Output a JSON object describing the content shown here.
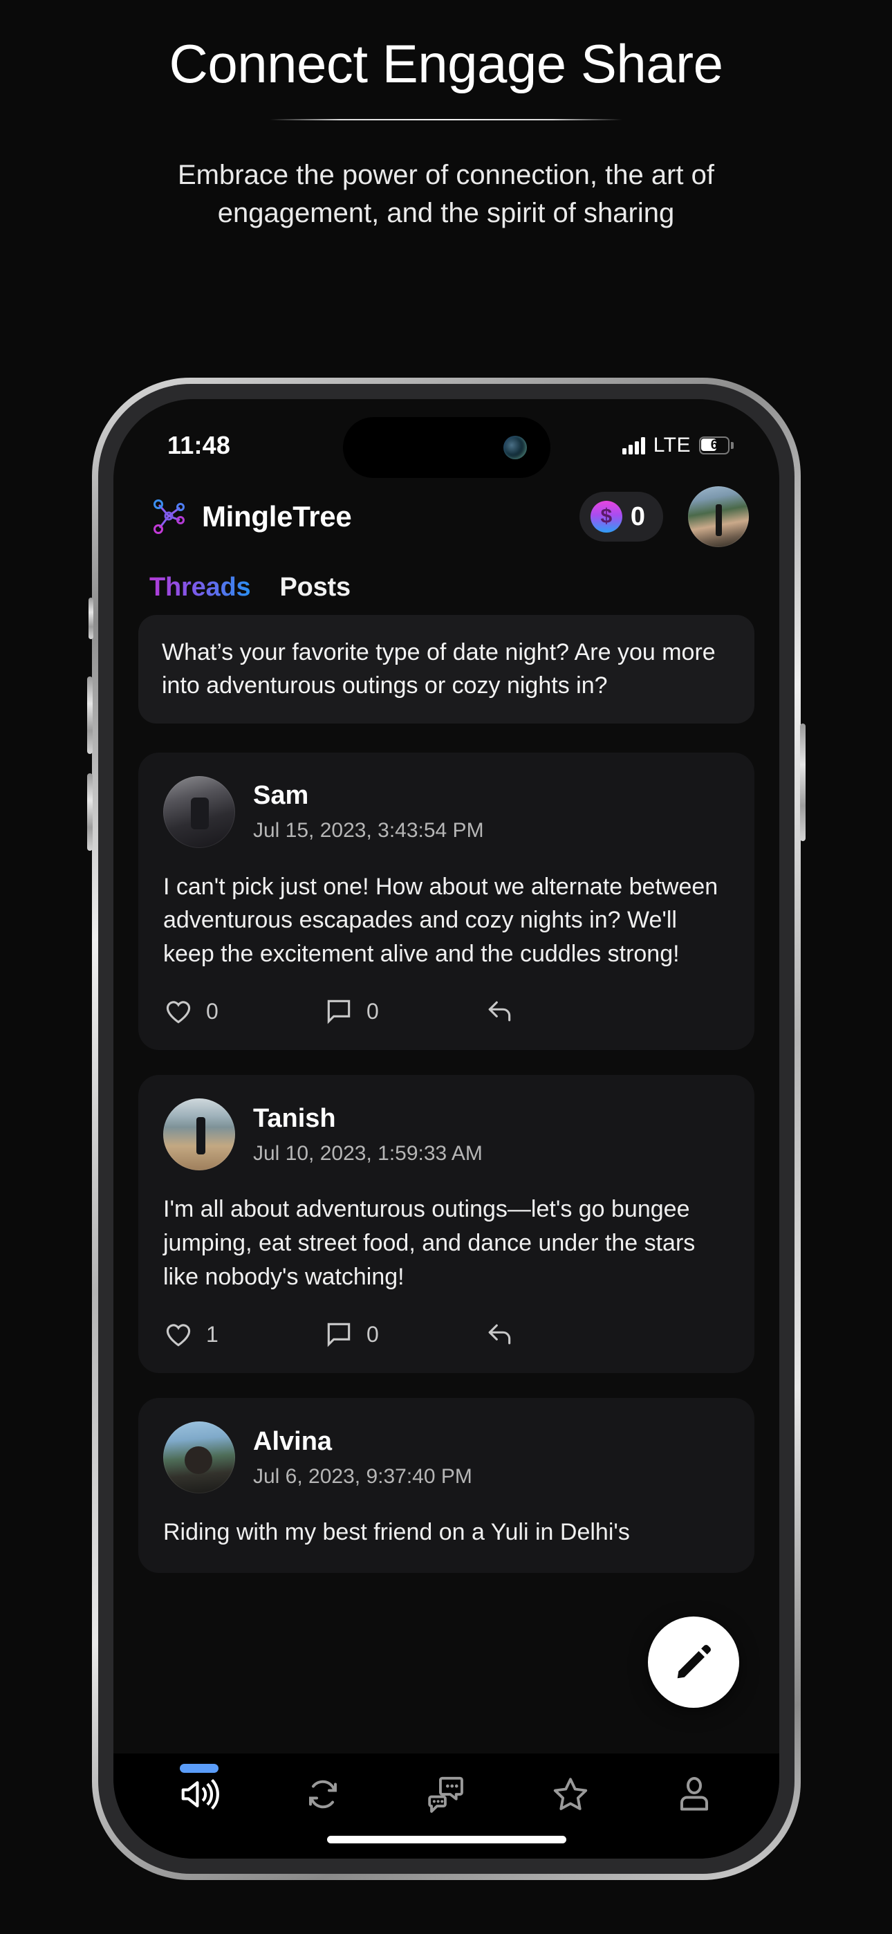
{
  "promo": {
    "title": "Connect Engage Share",
    "subtitle": "Embrace the power of connection, the art of engagement, and the spirit of sharing"
  },
  "status_bar": {
    "time": "11:48",
    "network": "LTE",
    "battery_level": "6",
    "signal_icon": "signal-bars-icon"
  },
  "app": {
    "name": "MingleTree",
    "logo_icon": "network-tree-icon",
    "coin_icon": "coin-dollar-icon",
    "coin_count": "0",
    "avatar_icon": "user-avatar"
  },
  "tabs": [
    {
      "label": "Threads",
      "active": true
    },
    {
      "label": "Posts",
      "active": false
    }
  ],
  "question": {
    "text": "What’s your favorite type of date night? Are you more into adventurous outings or cozy nights in?"
  },
  "posts": [
    {
      "author": "Sam",
      "timestamp": "Jul 15, 2023, 3:43:54 PM",
      "body": "I can't pick just one! How about we alternate between adventurous escapades and cozy nights in? We'll keep the excitement alive and the cuddles strong!",
      "like_count": "0",
      "comment_count": "0",
      "like_icon": "heart-icon",
      "comment_icon": "comment-bubble-icon",
      "share_icon": "reply-arrow-icon"
    },
    {
      "author": "Tanish",
      "timestamp": "Jul 10, 2023, 1:59:33 AM",
      "body": "I'm all about adventurous outings—let's go bungee jumping, eat street food, and dance under the stars like nobody's watching!",
      "like_count": "1",
      "comment_count": "0",
      "like_icon": "heart-icon",
      "comment_icon": "comment-bubble-icon",
      "share_icon": "reply-arrow-icon"
    },
    {
      "author": "Alvina",
      "timestamp": "Jul 6, 2023, 9:37:40 PM",
      "body": "Riding with my best friend on a Yuli in Delhi's",
      "like_count": "",
      "comment_count": "",
      "like_icon": "heart-icon",
      "comment_icon": "comment-bubble-icon",
      "share_icon": "reply-arrow-icon"
    }
  ],
  "fab": {
    "icon": "pencil-edit-icon"
  },
  "bottom_nav": [
    {
      "icon": "speaker-announce-icon",
      "active": true
    },
    {
      "icon": "refresh-sync-icon",
      "active": false
    },
    {
      "icon": "chat-bubbles-icon",
      "active": false
    },
    {
      "icon": "star-icon",
      "active": false
    },
    {
      "icon": "person-icon",
      "active": false
    }
  ],
  "colors": {
    "accent_purple": "#b43bd6",
    "accent_blue": "#2b8ff0",
    "nav_active": "#5b9df9",
    "background": "#0a0a0a",
    "card": "#161618"
  }
}
